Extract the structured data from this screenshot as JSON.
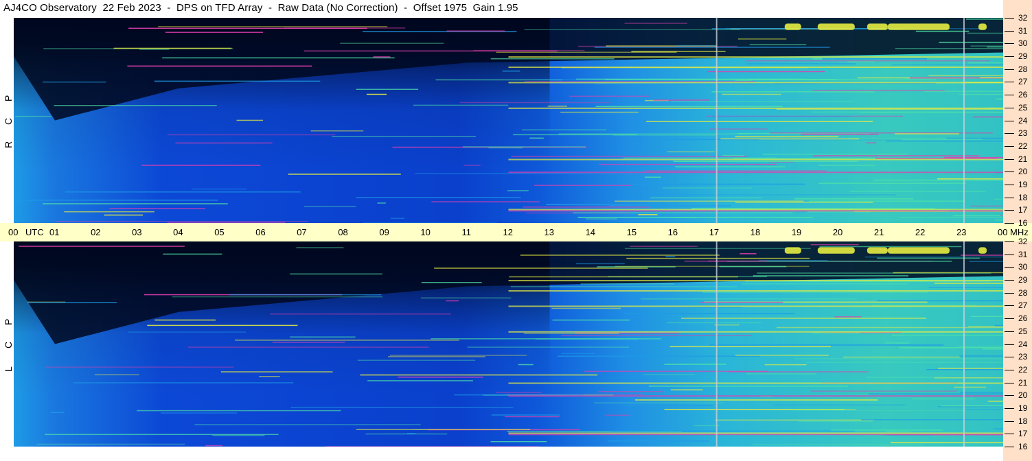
{
  "title": "AJ4CO Observatory  22 Feb 2023  -  DPS on TFD Array  -  Raw Data (No Correction)  -  Offset 1975  Gain 1.95",
  "chart_data": {
    "type": "heatmap",
    "panels": [
      {
        "name": "R C P",
        "letters": [
          "R",
          "C",
          "P"
        ]
      },
      {
        "name": "L C P",
        "letters": [
          "L",
          "C",
          "P"
        ]
      }
    ],
    "x_axis": {
      "unit_label": "UTC",
      "ticks": [
        "00",
        "01",
        "02",
        "03",
        "04",
        "05",
        "06",
        "07",
        "08",
        "09",
        "10",
        "11",
        "12",
        "13",
        "14",
        "15",
        "16",
        "17",
        "18",
        "19",
        "20",
        "21",
        "22",
        "23",
        "00"
      ],
      "range_hours": [
        0,
        24
      ]
    },
    "y_axis": {
      "unit_label": "MHz",
      "ticks": [
        16,
        17,
        18,
        19,
        20,
        21,
        22,
        23,
        24,
        25,
        26,
        27,
        28,
        29,
        30,
        31,
        32
      ],
      "range_mhz": [
        16,
        32
      ]
    },
    "vertical_markers_utc": [
      17.05,
      23.05
    ],
    "colors": {
      "background_dark": "#000820",
      "low": "#0a3ccf",
      "mid": "#1e9be6",
      "high": "#4fe3a6",
      "hot": "#e6ec40",
      "peak": "#e040b0",
      "axis_bg": "#ffffc8",
      "freq_bg": "#ffe0c8"
    }
  }
}
